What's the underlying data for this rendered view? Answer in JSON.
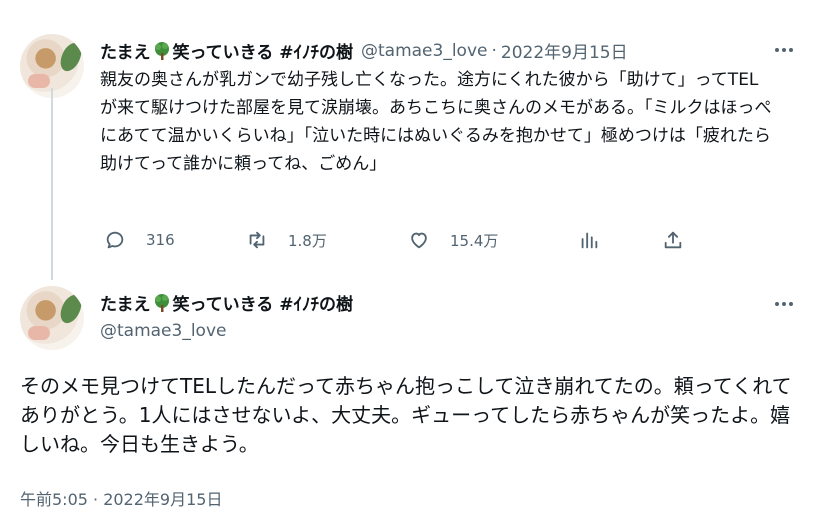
{
  "tweet": {
    "display_name_prefix": "たまえ",
    "display_name_suffix": "笑っていきる #ｲﾉﾁの樹",
    "tree_icon": "deciduous-tree-icon",
    "handle": "@tamae3_love",
    "separator": "·",
    "date": "2022年9月15日",
    "text": "親友の奥さんが乳ガンで幼子残し亡くなった。途方にくれた彼から「助けて」ってTELが来て駆けつけた部屋を見て涙崩壊。あちこちに奥さんのメモがある。「ミルクはほっぺにあてて温かいくらいね」「泣いた時にはぬいぐるみを抱かせて」極めつけは「疲れたら助けてって誰かに頼ってね、ごめん」",
    "replies": "316",
    "retweets": "1.8万",
    "likes": "15.4万"
  },
  "reply": {
    "display_name_prefix": "たまえ",
    "display_name_suffix": "笑っていきる #ｲﾉﾁの樹",
    "handle": "@tamae3_love",
    "text": "そのメモ見つけてTELしたんだって赤ちゃん抱っこして泣き崩れてたの。頼ってくれてありがとう。1人にはさせないよ、大丈夫。ギューってしたら赤ちゃんが笑ったよ。嬉しいね。今日も生きよう。",
    "timestamp": "午前5:05 · 2022年9月15日"
  },
  "colors": {
    "text": "#0f1419",
    "secondary": "#536471",
    "thread_line": "#cfd9de"
  }
}
